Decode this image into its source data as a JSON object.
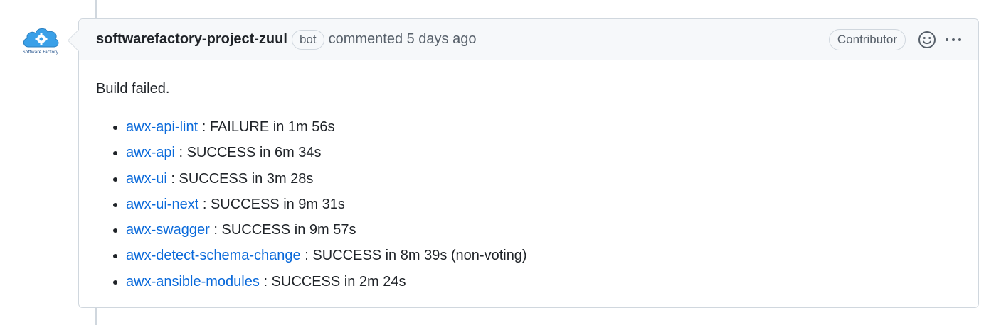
{
  "avatar": {
    "caption": "Software Factory",
    "accent": "#3aa0e8"
  },
  "comment": {
    "author": "softwarefactory-project-zuul",
    "bot_label": "bot",
    "commented_text": "commented 5 days ago",
    "role_label": "Contributor",
    "emoji_icon": "smiley-icon",
    "menu_icon": "kebab-horizontal-icon",
    "body_intro": "Build failed.",
    "jobs": [
      {
        "name": "awx-api-lint",
        "result": ": FAILURE in 1m 56s"
      },
      {
        "name": "awx-api",
        "result": ": SUCCESS in 6m 34s"
      },
      {
        "name": "awx-ui",
        "result": ": SUCCESS in 3m 28s"
      },
      {
        "name": "awx-ui-next",
        "result": ": SUCCESS in 9m 31s"
      },
      {
        "name": "awx-swagger",
        "result": ": SUCCESS in 9m 57s"
      },
      {
        "name": "awx-detect-schema-change",
        "result": ": SUCCESS in 8m 39s (non-voting)"
      },
      {
        "name": "awx-ansible-modules",
        "result": ": SUCCESS in 2m 24s"
      }
    ]
  },
  "colors": {
    "link": "#0969da",
    "border": "#d0d7de",
    "header_bg": "#f6f8fa",
    "muted": "#57606a"
  }
}
